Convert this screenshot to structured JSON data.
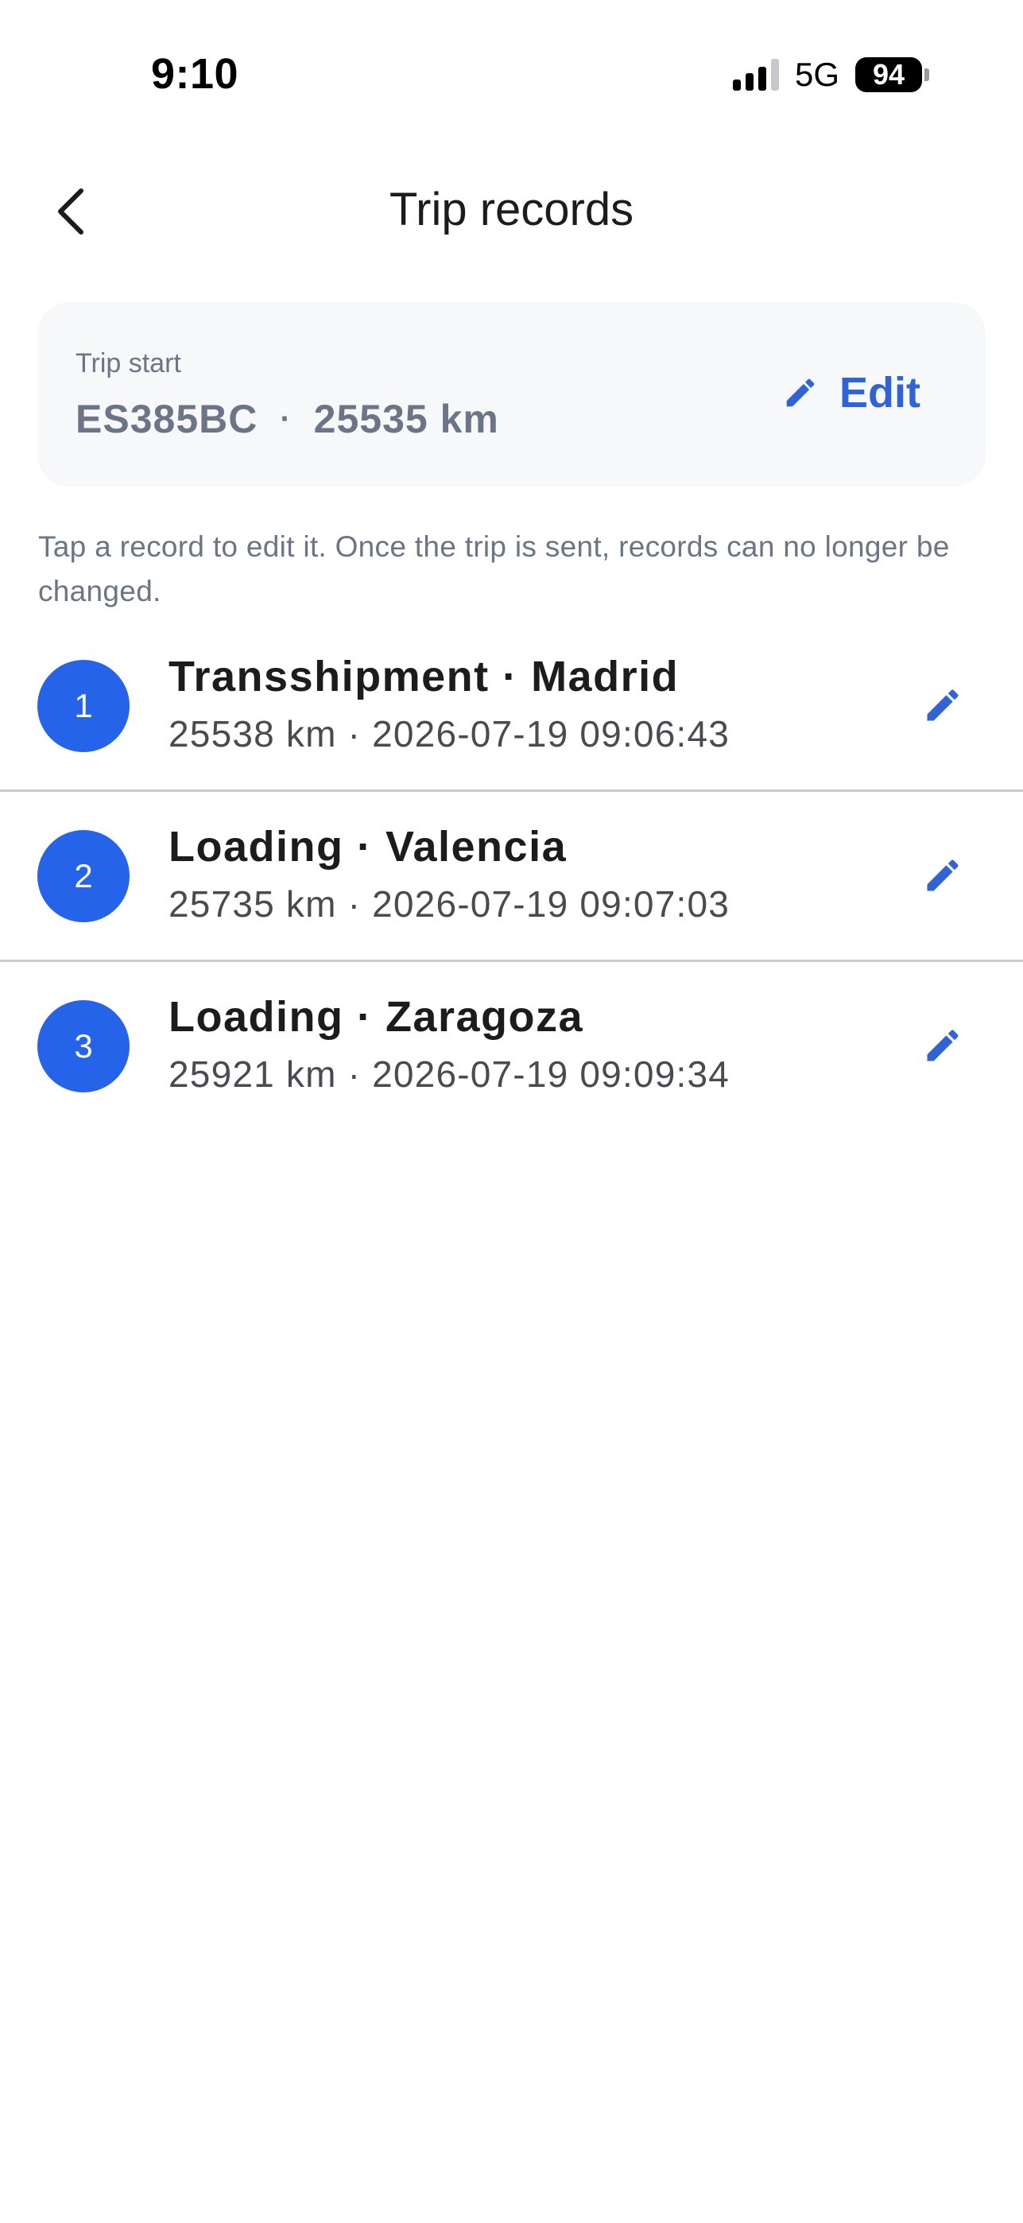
{
  "status_bar": {
    "time": "9:10",
    "network": "5G",
    "battery": "94"
  },
  "nav": {
    "title": "Trip records"
  },
  "trip_start": {
    "label": "Trip start",
    "plate": "ES385BC",
    "separator": "·",
    "odometer": "25535 km",
    "edit_label": "Edit"
  },
  "hint": "Tap a record to edit it. Once the trip is sent, records can no longer be changed.",
  "records": [
    {
      "number": "1",
      "title": "Transshipment · Madrid",
      "meta": "25538 km · 2026-07-19 09:06:43"
    },
    {
      "number": "2",
      "title": "Loading · Valencia",
      "meta": "25735 km · 2026-07-19 09:07:03"
    },
    {
      "number": "3",
      "title": "Loading · Zaragoza",
      "meta": "25921 km · 2026-07-19 09:09:34"
    }
  ],
  "colors": {
    "accent": "#2563e8",
    "edit_text": "#2f63d6",
    "muted_text": "#6b7585",
    "card_bg": "#f7f8fa"
  },
  "icons": {
    "back": "chevron-left-icon",
    "edit": "pencil-icon"
  }
}
